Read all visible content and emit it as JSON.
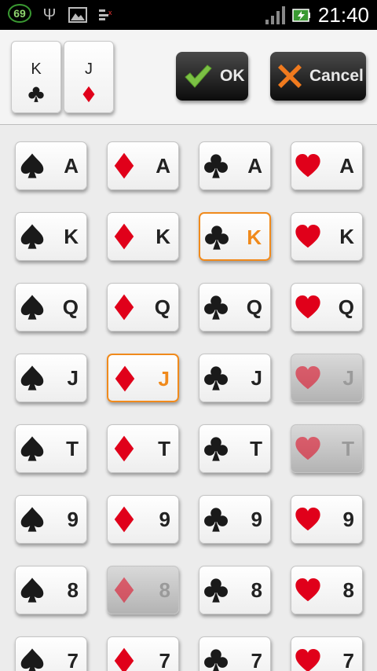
{
  "status_bar": {
    "battery_percent": "69",
    "time": "21:40",
    "icons": [
      "battery-percent-icon",
      "usb-icon",
      "image-icon",
      "sim-icon",
      "signal-icon",
      "charging-battery-icon"
    ]
  },
  "selected_cards": [
    {
      "rank": "K",
      "suit": "clubs"
    },
    {
      "rank": "J",
      "suit": "diamonds"
    }
  ],
  "buttons": {
    "ok_label": "OK",
    "cancel_label": "Cancel"
  },
  "colors": {
    "red_suit": "#e0001a",
    "black_suit": "#1a1a1a",
    "selection": "#f08a1c"
  },
  "suits": [
    "spades",
    "diamonds",
    "clubs",
    "hearts"
  ],
  "rows": [
    {
      "rank": "A",
      "states": [
        "normal",
        "normal",
        "normal",
        "normal"
      ]
    },
    {
      "rank": "K",
      "states": [
        "normal",
        "normal",
        "selected",
        "normal"
      ]
    },
    {
      "rank": "Q",
      "states": [
        "normal",
        "normal",
        "normal",
        "normal"
      ]
    },
    {
      "rank": "J",
      "states": [
        "normal",
        "selected",
        "normal",
        "disabled"
      ]
    },
    {
      "rank": "T",
      "states": [
        "normal",
        "normal",
        "normal",
        "disabled"
      ]
    },
    {
      "rank": "9",
      "states": [
        "normal",
        "normal",
        "normal",
        "normal"
      ]
    },
    {
      "rank": "8",
      "states": [
        "normal",
        "disabled",
        "normal",
        "normal"
      ]
    },
    {
      "rank": "7",
      "states": [
        "normal",
        "normal",
        "normal",
        "normal"
      ]
    }
  ]
}
